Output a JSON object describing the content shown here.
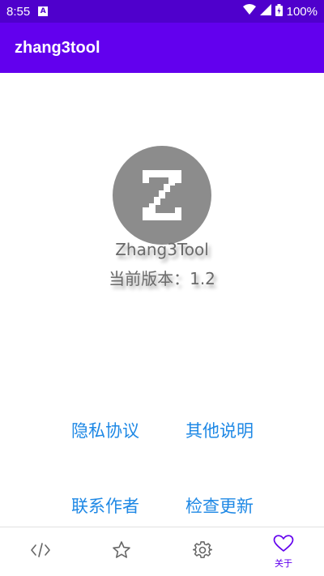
{
  "status_bar": {
    "time": "8:55",
    "notification_icon": "A",
    "battery": "100%"
  },
  "app_bar": {
    "title": "zhang3tool"
  },
  "about": {
    "logo_letter": "Z",
    "app_name": "Zhang3Tool",
    "version_label": "当前版本：",
    "version_value": "1.2"
  },
  "links": {
    "privacy": "隐私协议",
    "other": "其他说明",
    "contact": "联系作者",
    "update": "检查更新"
  },
  "bottom_nav": {
    "items": [
      {
        "icon": "code-icon",
        "label": ""
      },
      {
        "icon": "star-icon",
        "label": ""
      },
      {
        "icon": "gear-icon",
        "label": ""
      },
      {
        "icon": "heart-icon",
        "label": "关于"
      }
    ],
    "active_index": 3
  },
  "colors": {
    "status_bar": "#4f00cc",
    "app_bar": "#6200ee",
    "link": "#1e88e5",
    "nav_active": "#6200ee",
    "nav_inactive": "#666666"
  }
}
